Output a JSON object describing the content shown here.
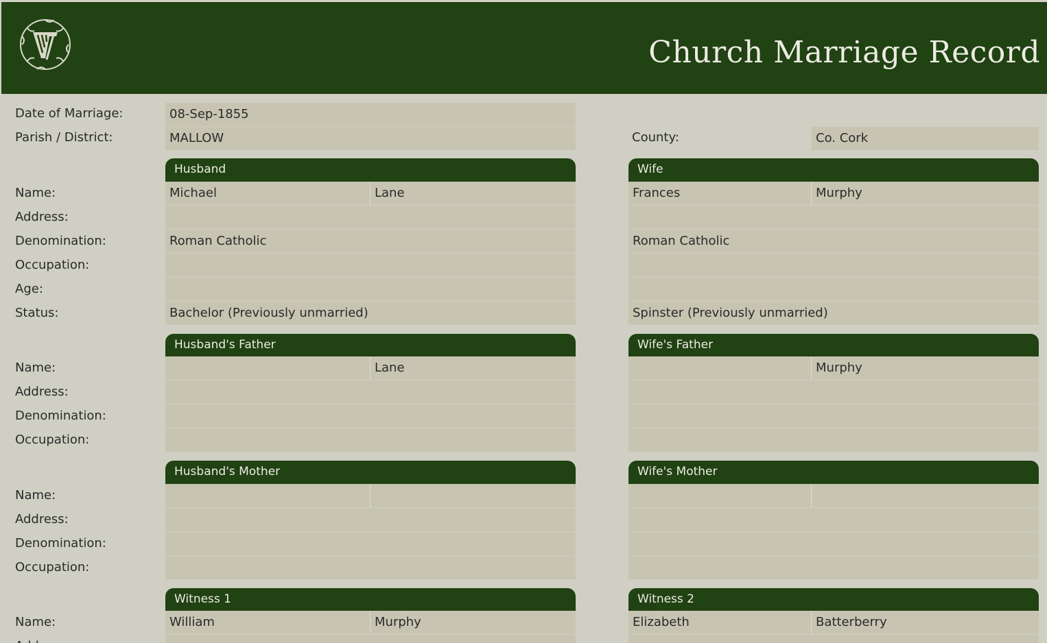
{
  "header": {
    "title": "Church Marriage Record",
    "logo_icon": "harp-emblem-icon"
  },
  "record": {
    "date_label": "Date of Marriage:",
    "date_value": "08-Sep-1855",
    "parish_label": "Parish / District:",
    "parish_value": "MALLOW",
    "county_label": "County:",
    "county_value": "Co. Cork"
  },
  "labels": {
    "name": "Name:",
    "address": "Address:",
    "denomination": "Denomination:",
    "occupation": "Occupation:",
    "age": "Age:",
    "status": "Status:"
  },
  "husband": {
    "title": "Husband",
    "first": "Michael",
    "last": "Lane",
    "address": "",
    "denomination": "Roman Catholic",
    "occupation": "",
    "age": "",
    "status": "Bachelor (Previously unmarried)"
  },
  "wife": {
    "title": "Wife",
    "first": "Frances",
    "last": "Murphy",
    "address": "",
    "denomination": "Roman Catholic",
    "occupation": "",
    "age": "",
    "status": "Spinster (Previously unmarried)"
  },
  "husband_father": {
    "title": "Husband's Father",
    "first": "",
    "last": "Lane",
    "address": "",
    "denomination": "",
    "occupation": ""
  },
  "wife_father": {
    "title": "Wife's Father",
    "first": "",
    "last": "Murphy",
    "address": "",
    "denomination": "",
    "occupation": ""
  },
  "husband_mother": {
    "title": "Husband's Mother",
    "first": "",
    "last": "",
    "address": "",
    "denomination": "",
    "occupation": ""
  },
  "wife_mother": {
    "title": "Wife's Mother",
    "first": "",
    "last": "",
    "address": "",
    "denomination": "",
    "occupation": ""
  },
  "witness1": {
    "title": "Witness 1",
    "first": "William",
    "last": "Murphy"
  },
  "witness2": {
    "title": "Witness 2",
    "first": "Elizabeth",
    "last": "Batterberry"
  },
  "colors": {
    "header_bg": "#214213",
    "field_bg": "#c7c5b2",
    "page_bg": "#cfcfc3"
  }
}
